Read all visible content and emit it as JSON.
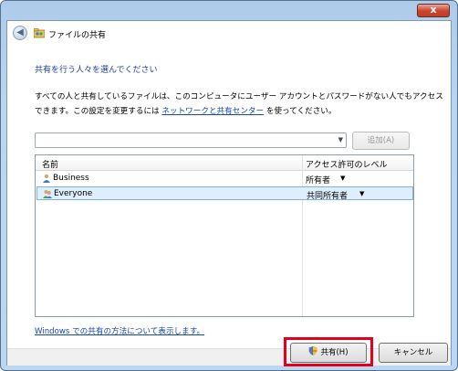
{
  "window": {
    "title": "ファイルの共有",
    "close_glyph": "x",
    "back_glyph": "◀"
  },
  "content": {
    "heading": "共有を行う人々を選んでください",
    "description_before_link": "すべての人と共有しているファイルは、このコンピュータにユーザー アカウントとパスワードがない人でもアクセスできます。この設定を変更するには ",
    "description_link": "ネットワークと共有センター",
    "description_after_link": " を使ってください。"
  },
  "picker": {
    "combo_value": "",
    "combo_arrow": "▼",
    "add_label": "追加(A)"
  },
  "list": {
    "columns": [
      "名前",
      "アクセス許可のレベル"
    ],
    "rows": [
      {
        "name": "Business",
        "permission": "所有者",
        "arrow": "▼",
        "icon": "user-icon"
      },
      {
        "name": "Everyone",
        "permission": "共同所有者",
        "arrow": "▼",
        "icon": "users-group-icon"
      }
    ]
  },
  "help_link": "Windows での共有の方法について表示します。",
  "buttons": {
    "share": "共有(H)",
    "cancel": "キャンセル"
  },
  "colors": {
    "heading": "#1e3f9a",
    "link": "#1547b3",
    "highlight": "#e3001b",
    "selected_row": "#dfeefb"
  }
}
